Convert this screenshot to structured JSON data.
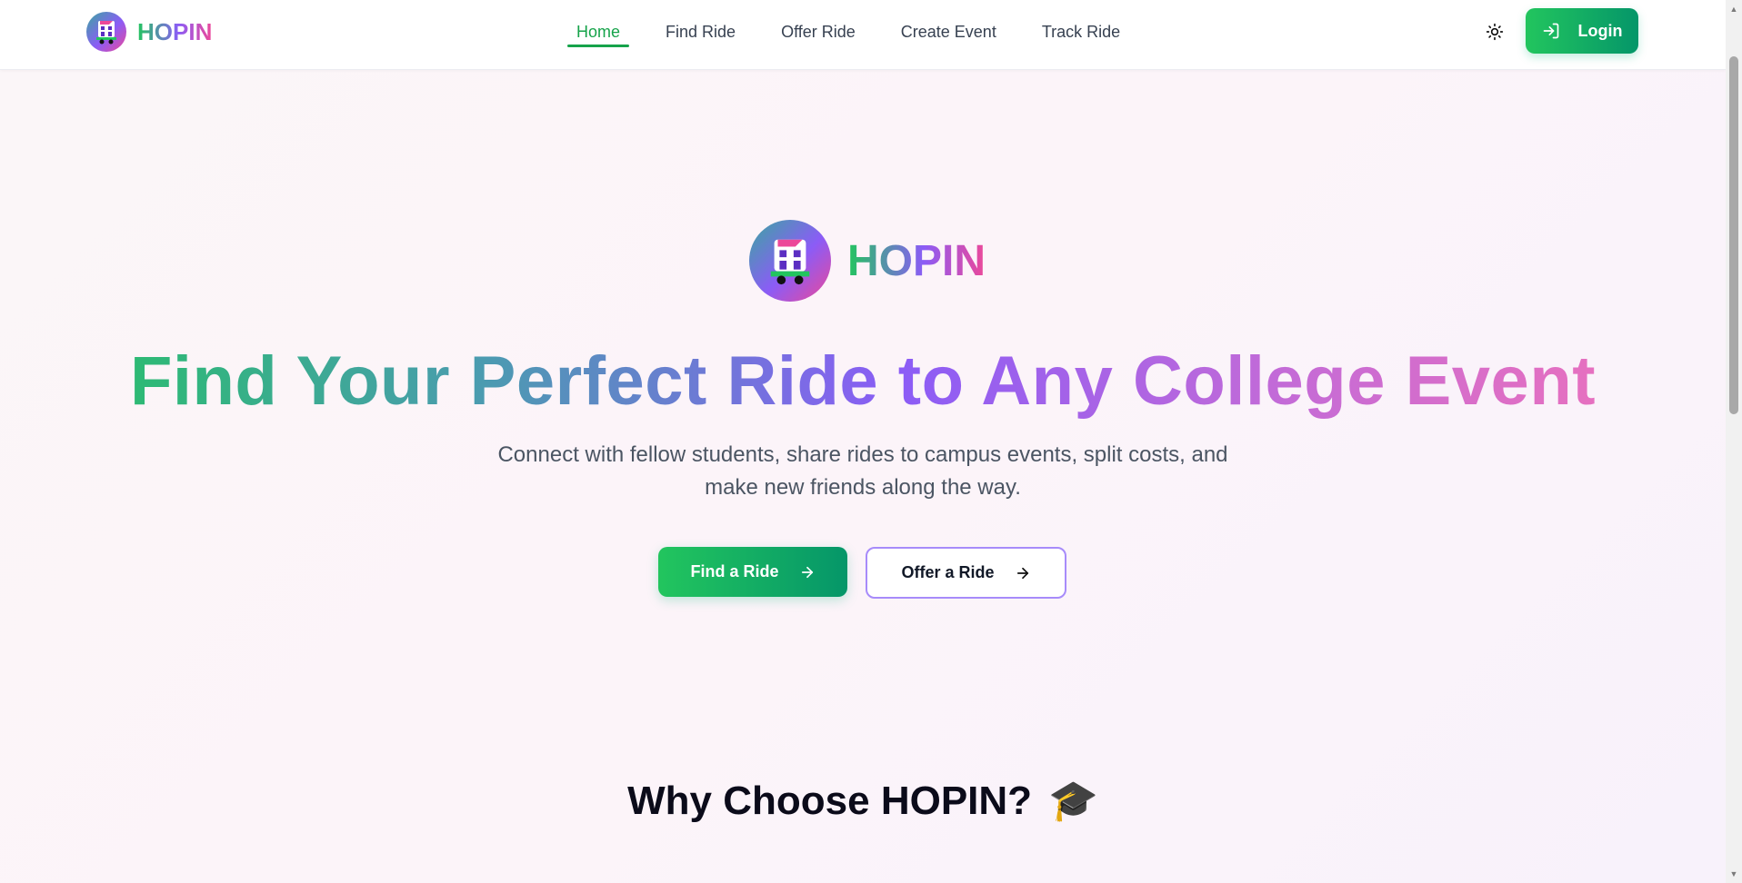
{
  "nav": {
    "brand": "HOPIN",
    "links": [
      {
        "label": "Home",
        "active": true
      },
      {
        "label": "Find Ride",
        "active": false
      },
      {
        "label": "Offer Ride",
        "active": false
      },
      {
        "label": "Create Event",
        "active": false
      },
      {
        "label": "Track Ride",
        "active": false
      }
    ],
    "theme_icon": "sun-icon",
    "login_label": "Login",
    "login_icon": "login-arrow-icon"
  },
  "hero": {
    "brand": "HOPIN",
    "headline": "Find Your Perfect Ride to Any College Event",
    "subtext": "Connect with fellow students, share rides to campus events, split costs, and make new friends along the way.",
    "primary_cta": "Find a Ride",
    "secondary_cta": "Offer a Ride"
  },
  "features": {
    "title": "Why Choose HOPIN?",
    "title_emoji": "🎓"
  },
  "colors": {
    "accent_green": "#22c55e",
    "accent_purple": "#8b5cf6",
    "accent_pink": "#ec4899"
  }
}
